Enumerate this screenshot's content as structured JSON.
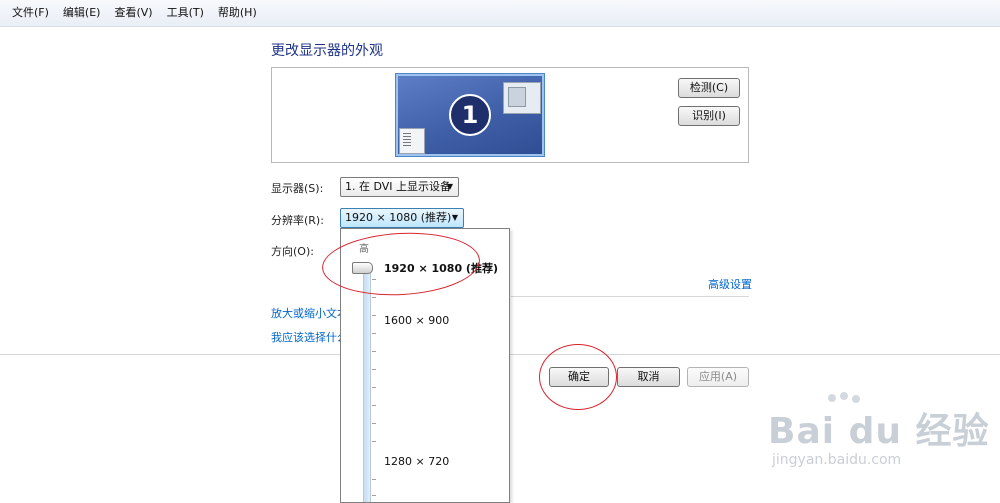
{
  "menu": {
    "items": [
      {
        "label": "文件(F)"
      },
      {
        "label": "编辑(E)"
      },
      {
        "label": "查看(V)"
      },
      {
        "label": "工具(T)"
      },
      {
        "label": "帮助(H)"
      }
    ]
  },
  "page": {
    "title": "更改显示器的外观",
    "monitor_number": "1",
    "detect_label": "检测(C)",
    "identify_label": "识别(I)"
  },
  "settings": {
    "display_label": "显示器(S):",
    "display_value": "1. 在 DVI 上显示设备",
    "resolution_label": "分辨率(R):",
    "resolution_value": "1920 × 1080 (推荐)",
    "orientation_label": "方向(O):"
  },
  "dropdown": {
    "top_label": "高",
    "options": [
      {
        "label": "1920 × 1080 (推荐)"
      },
      {
        "label": "1600 × 900"
      },
      {
        "label": "1280 × 720"
      }
    ],
    "selected_index": 0
  },
  "links": {
    "advanced": "高级设置",
    "text_size": "放大或缩小文本",
    "which_setting": "我应该选择什么"
  },
  "buttons": {
    "ok": "确定",
    "cancel": "取消",
    "apply": "应用(A)"
  },
  "watermark": {
    "main": "Bai du 经验",
    "sub": "jingyan.baidu.com"
  },
  "colors": {
    "link": "#0066cc",
    "annotation": "#d9232d",
    "title": "#1e3287"
  }
}
